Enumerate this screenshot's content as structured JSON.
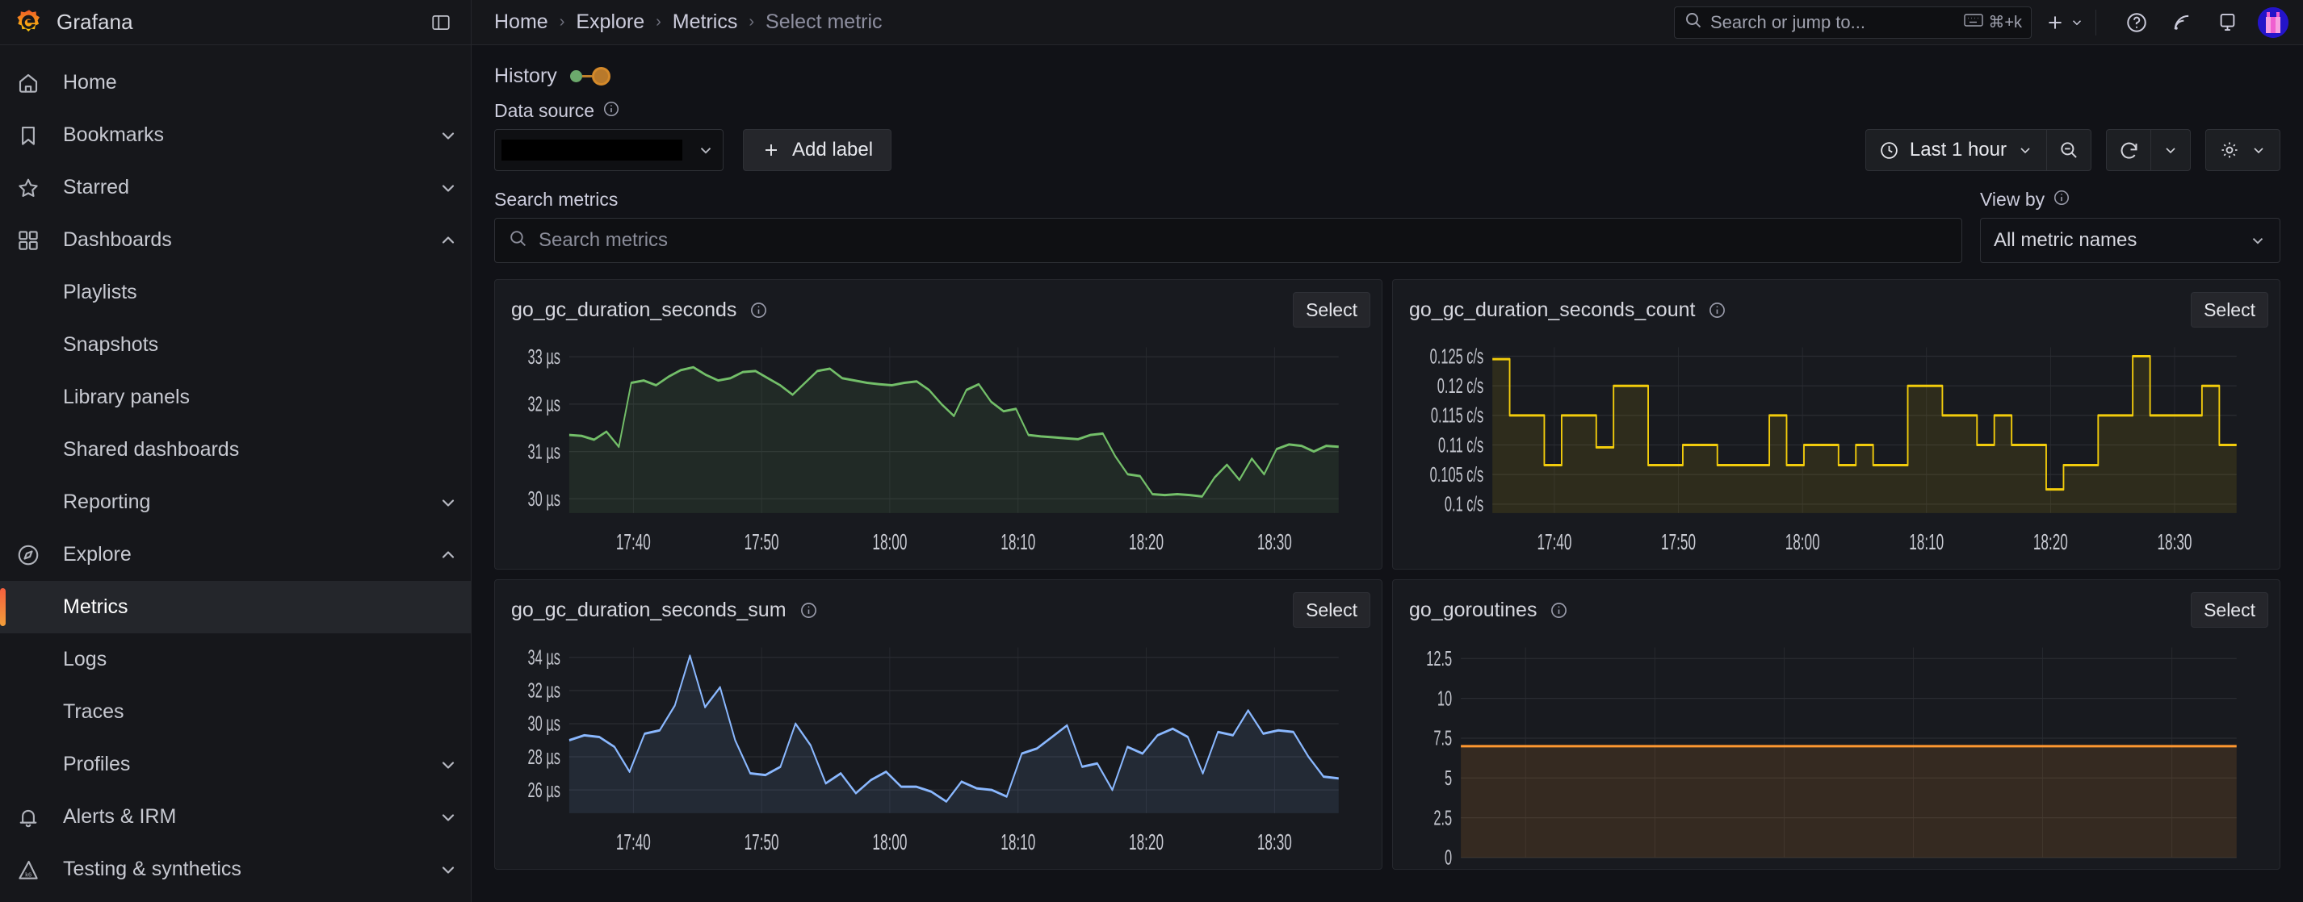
{
  "app": {
    "brand": "Grafana",
    "logo_icon": "grafana-logo-icon",
    "dock_icon": "dock-menu-icon"
  },
  "sidebar": {
    "items": [
      {
        "label": "Home",
        "icon": "home-icon",
        "chevron": "",
        "level": "top",
        "active": false
      },
      {
        "label": "Bookmarks",
        "icon": "bookmark-icon",
        "chevron": "down",
        "level": "top",
        "active": false
      },
      {
        "label": "Starred",
        "icon": "star-icon",
        "chevron": "down",
        "level": "top",
        "active": false
      },
      {
        "label": "Dashboards",
        "icon": "apps-grid-icon",
        "chevron": "up",
        "level": "top",
        "active": false
      },
      {
        "label": "Playlists",
        "icon": "",
        "chevron": "",
        "level": "child",
        "active": false
      },
      {
        "label": "Snapshots",
        "icon": "",
        "chevron": "",
        "level": "child",
        "active": false
      },
      {
        "label": "Library panels",
        "icon": "",
        "chevron": "",
        "level": "child",
        "active": false
      },
      {
        "label": "Shared dashboards",
        "icon": "",
        "chevron": "",
        "level": "child",
        "active": false
      },
      {
        "label": "Reporting",
        "icon": "",
        "chevron": "down",
        "level": "child",
        "active": false
      },
      {
        "label": "Explore",
        "icon": "compass-icon",
        "chevron": "up",
        "level": "top",
        "active": false
      },
      {
        "label": "Metrics",
        "icon": "",
        "chevron": "",
        "level": "child",
        "active": true
      },
      {
        "label": "Logs",
        "icon": "",
        "chevron": "",
        "level": "child",
        "active": false
      },
      {
        "label": "Traces",
        "icon": "",
        "chevron": "",
        "level": "child",
        "active": false
      },
      {
        "label": "Profiles",
        "icon": "",
        "chevron": "down",
        "level": "child",
        "active": false
      },
      {
        "label": "Alerts & IRM",
        "icon": "bell-icon",
        "chevron": "down",
        "level": "top",
        "active": false
      },
      {
        "label": "Testing & synthetics",
        "icon": "k6-mountain-icon",
        "chevron": "down",
        "level": "top",
        "active": false
      }
    ]
  },
  "topbar": {
    "breadcrumbs": [
      "Home",
      "Explore",
      "Metrics",
      "Select metric"
    ],
    "separator": "›",
    "search": {
      "placeholder": "Search or jump to...",
      "shortcut": "⌘+k",
      "search_icon": "search-icon",
      "keyboard_icon": "keyboard-icon"
    },
    "actions": [
      {
        "name": "add-new-button",
        "icon": "plus-icon",
        "caret": true
      },
      {
        "name": "help-button",
        "icon": "question-circle-icon",
        "caret": false
      },
      {
        "name": "news-button",
        "icon": "rss-icon",
        "caret": false
      },
      {
        "name": "monitor-button",
        "icon": "monitor-icon",
        "caret": false
      }
    ],
    "avatar_icon": "user-avatar"
  },
  "toolbar": {
    "history_label": "History",
    "data_source_label": "Data source",
    "data_source_value": "",
    "data_source_info_icon": "info-circle-icon",
    "add_label_button": "Add label",
    "add_label_icon": "plus-icon",
    "time_range": "Last 1 hour",
    "time_icon": "clock-icon",
    "zoom_out_icon": "zoom-out-icon",
    "refresh_icon": "refresh-icon",
    "settings_icon": "gear-icon",
    "caret_icon": "chevron-down-icon"
  },
  "search_section": {
    "label": "Search metrics",
    "placeholder": "Search metrics",
    "search_icon": "search-icon",
    "view_by_label": "View by",
    "view_by_info_icon": "info-circle-icon",
    "view_by_value": "All metric names",
    "view_by_options": [
      "All metric names"
    ]
  },
  "panels": [
    {
      "title": "go_gc_duration_seconds",
      "info_icon": "info-circle-icon",
      "select_label": "Select",
      "color": "#73bf69",
      "fill": "rgba(115,191,105,0.10)"
    },
    {
      "title": "go_gc_duration_seconds_count",
      "info_icon": "info-circle-icon",
      "select_label": "Select",
      "color": "#f2cc0c",
      "fill": "rgba(242,204,12,0.10)"
    },
    {
      "title": "go_gc_duration_seconds_sum",
      "info_icon": "info-circle-icon",
      "select_label": "Select",
      "color": "#8ab8ff",
      "fill": "rgba(138,184,255,0.10)"
    },
    {
      "title": "go_goroutines",
      "info_icon": "info-circle-icon",
      "select_label": "Select",
      "color": "#ff9830",
      "fill": "rgba(255,152,48,0.13)"
    }
  ],
  "chart_data": [
    {
      "type": "area",
      "title": "go_gc_duration_seconds",
      "xlabel": "",
      "ylabel": "",
      "unit": "µs",
      "ylim": [
        29.7,
        33.2
      ],
      "yticks": [
        30,
        31,
        32,
        33
      ],
      "ytick_labels": [
        "30 µs",
        "31 µs",
        "32 µs",
        "33 µs"
      ],
      "xticks": [
        "17:40",
        "17:50",
        "18:00",
        "18:10",
        "18:20",
        "18:30"
      ],
      "grid": true,
      "legend": "none",
      "series": [
        {
          "name": "go_gc_duration_seconds",
          "color": "#73bf69",
          "values": [
            31.35,
            31.33,
            31.25,
            31.42,
            31.1,
            32.45,
            32.5,
            32.4,
            32.58,
            32.72,
            32.78,
            32.62,
            32.5,
            32.55,
            32.68,
            32.7,
            32.55,
            32.4,
            32.2,
            32.45,
            32.7,
            32.75,
            32.55,
            32.5,
            32.45,
            32.42,
            32.4,
            32.45,
            32.48,
            32.3,
            32.0,
            31.75,
            32.3,
            32.42,
            32.05,
            31.85,
            31.9,
            31.35,
            31.32,
            31.3,
            31.28,
            31.26,
            31.35,
            31.38,
            30.9,
            30.52,
            30.48,
            30.1,
            30.08,
            30.1,
            30.08,
            30.05,
            30.45,
            30.72,
            30.4,
            30.85,
            30.52,
            31.05,
            31.15,
            31.12,
            31.0,
            31.12,
            31.1
          ]
        }
      ]
    },
    {
      "type": "area",
      "title": "go_gc_duration_seconds_count",
      "xlabel": "",
      "ylabel": "",
      "unit": "c/s",
      "ylim": [
        0.0985,
        0.1265
      ],
      "yticks": [
        0.1,
        0.105,
        0.11,
        0.115,
        0.12,
        0.125
      ],
      "ytick_labels": [
        "0.1 c/s",
        "0.105 c/s",
        "0.11 c/s",
        "0.115 c/s",
        "0.12 c/s",
        "0.125 c/s"
      ],
      "xticks": [
        "17:40",
        "17:50",
        "18:00",
        "18:10",
        "18:20",
        "18:30"
      ],
      "grid": true,
      "legend": "none",
      "series": [
        {
          "name": "go_gc_duration_seconds_count",
          "color": "#f2cc0c",
          "values": [
            0.1245,
            0.115,
            0.115,
            0.1066,
            0.115,
            0.115,
            0.1096,
            0.12,
            0.12,
            0.1066,
            0.1066,
            0.11,
            0.11,
            0.1066,
            0.1066,
            0.1066,
            0.115,
            0.1066,
            0.11,
            0.11,
            0.1066,
            0.11,
            0.1066,
            0.1066,
            0.12,
            0.12,
            0.115,
            0.115,
            0.11,
            0.115,
            0.11,
            0.11,
            0.1025,
            0.1066,
            0.1066,
            0.115,
            0.115,
            0.125,
            0.115,
            0.115,
            0.115,
            0.12,
            0.11,
            0.11
          ]
        }
      ]
    },
    {
      "type": "area",
      "title": "go_gc_duration_seconds_sum",
      "xlabel": "",
      "ylabel": "",
      "unit": "µs",
      "ylim": [
        24.6,
        34.6
      ],
      "yticks": [
        26,
        28,
        30,
        32,
        34
      ],
      "ytick_labels": [
        "26 µs",
        "28 µs",
        "30 µs",
        "32 µs",
        "34 µs"
      ],
      "xticks": [
        "17:40",
        "17:50",
        "18:00",
        "18:10",
        "18:20",
        "18:30"
      ],
      "grid": true,
      "legend": "none",
      "series": [
        {
          "name": "go_gc_duration_seconds_sum",
          "color": "#8ab8ff",
          "values": [
            29.0,
            29.3,
            29.2,
            28.6,
            27.1,
            29.4,
            29.6,
            31.1,
            34.1,
            31.0,
            32.2,
            29.0,
            27.0,
            26.9,
            27.4,
            30.0,
            28.7,
            26.4,
            27.0,
            25.8,
            26.6,
            27.1,
            26.2,
            26.2,
            25.9,
            25.3,
            26.5,
            26.1,
            26.0,
            25.6,
            28.2,
            28.5,
            29.2,
            29.9,
            27.4,
            27.6,
            26.0,
            28.6,
            28.2,
            29.3,
            29.7,
            29.2,
            27.0,
            29.5,
            29.3,
            30.8,
            29.4,
            29.6,
            29.5,
            28.0,
            26.8,
            26.7
          ]
        }
      ]
    },
    {
      "type": "area",
      "title": "go_goroutines",
      "xlabel": "",
      "ylabel": "",
      "unit": "",
      "ylim": [
        0,
        13.2
      ],
      "yticks": [
        0,
        2.5,
        5,
        7.5,
        10,
        12.5
      ],
      "ytick_labels": [
        "0",
        "2.5",
        "5",
        "7.5",
        "10",
        "12.5"
      ],
      "xticks": [],
      "grid": true,
      "legend": "none",
      "series": [
        {
          "name": "go_goroutines",
          "color": "#ff9830",
          "values": [
            7,
            7,
            7,
            7,
            7,
            7,
            7,
            7,
            7,
            7,
            7,
            7,
            7,
            7,
            7,
            7,
            7,
            7,
            7,
            7
          ]
        }
      ]
    }
  ]
}
